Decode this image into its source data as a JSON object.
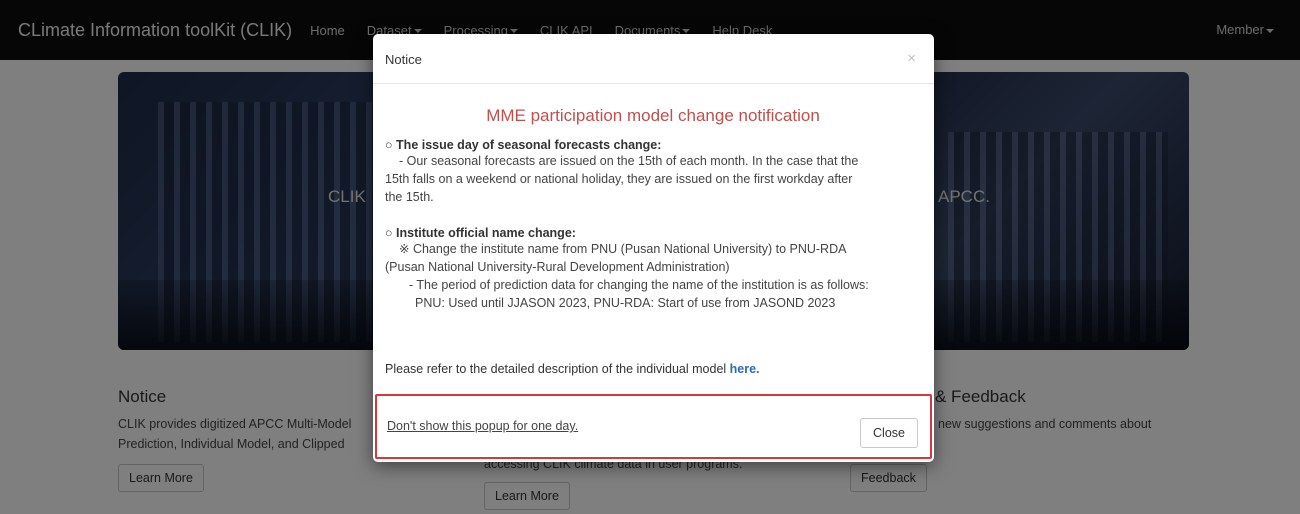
{
  "navbar": {
    "brand": "CLimate Information toolKit (CLIK)",
    "items": [
      {
        "label": "Home",
        "dropdown": false
      },
      {
        "label": "Dataset",
        "dropdown": true
      },
      {
        "label": "Processing",
        "dropdown": true
      },
      {
        "label": "CLIK API",
        "dropdown": false
      },
      {
        "label": "Documents",
        "dropdown": true
      },
      {
        "label": "Help Desk",
        "dropdown": false
      }
    ],
    "member": "Member"
  },
  "hero": {
    "text_left": "CLIK",
    "text_right": "APCC."
  },
  "columns": {
    "notice": {
      "title": "Notice",
      "text_line1": "CLIK provides digitized APCC Multi-Model",
      "text_line2": "Prediction, Individual Model, and Clipped",
      "button": "Learn More"
    },
    "api": {
      "text_line": "accessing CLIK climate data in user programs.",
      "button": "Learn More"
    },
    "feedback": {
      "title": "& Feedback",
      "text_line1": "new suggestions and comments about",
      "button": "Feedback"
    }
  },
  "modal": {
    "title": "Notice",
    "close_symbol": "×",
    "heading": "MME participation model change notification",
    "section1": {
      "bullet": "○",
      "title": "The issue day of seasonal forecasts change:",
      "line1": "- Our seasonal forecasts are issued on the 15th of each month. In the case that the",
      "line2": "15th falls on a weekend or national holiday, they are issued on the first workday after",
      "line3": "the 15th."
    },
    "section2": {
      "bullet": "○",
      "title": "Institute official name change:",
      "line1": "※ Change the institute name from PNU (Pusan National University) to PNU-RDA",
      "line2": "(Pusan National University-Rural Development Administration)",
      "line3": "- The period of prediction data for changing the name of the institution is as follows:",
      "line4": "PNU: Used until JJASON 2023, PNU-RDA: Start of use from JASOND 2023"
    },
    "refer_text": "Please refer to the detailed description of the individual model ",
    "refer_link": "here.",
    "dont_show": "Don't show this popup for one day.",
    "close_button": "Close"
  },
  "colors": {
    "navbar_bg": "#0d0d0d",
    "heading_red": "#c0504d",
    "link_blue": "#2e6bb5",
    "highlight_border": "#d9363e"
  }
}
